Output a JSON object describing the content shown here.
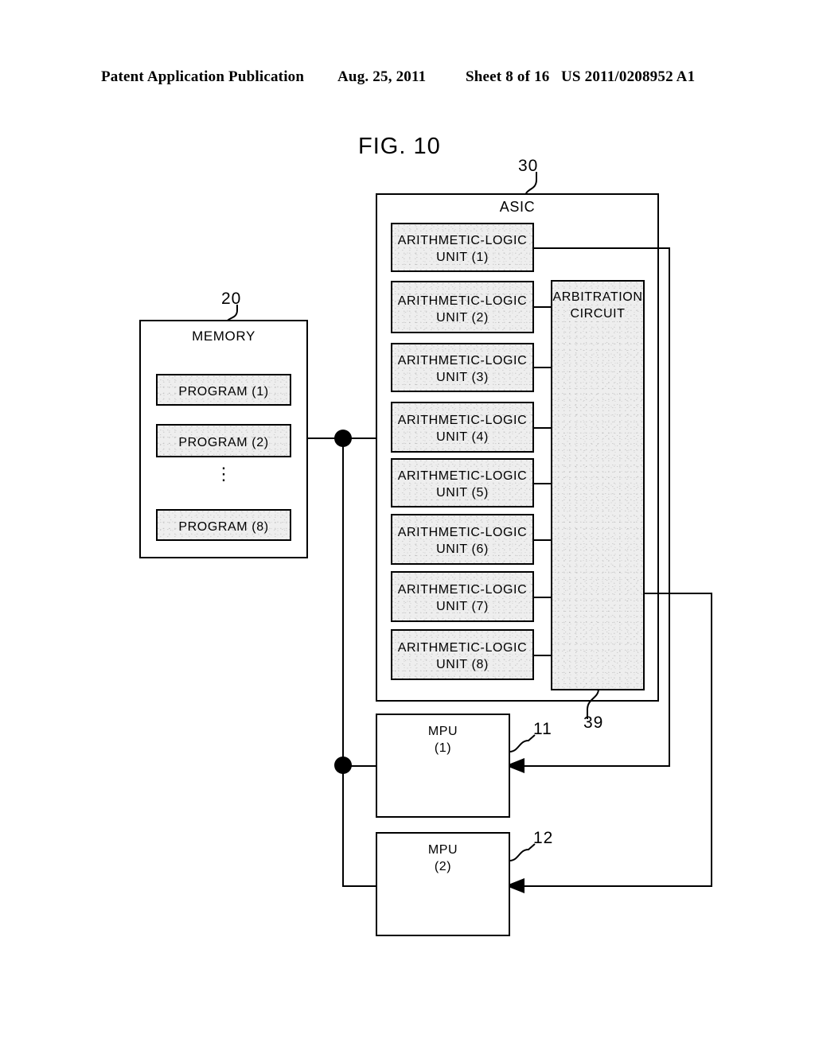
{
  "header": {
    "publication": "Patent Application Publication",
    "date": "Aug. 25, 2011",
    "sheet": "Sheet 8 of 16",
    "document_number": "US 2011/0208952 A1"
  },
  "figure": {
    "title": "FIG. 10"
  },
  "reference_numerals": {
    "asic": "30",
    "memory": "20",
    "arbitration_circuit": "39",
    "mpu1": "11",
    "mpu2": "12"
  },
  "asic": {
    "label": "ASIC",
    "units": [
      {
        "line1": "ARITHMETIC-LOGIC",
        "line2": "UNIT (1)"
      },
      {
        "line1": "ARITHMETIC-LOGIC",
        "line2": "UNIT (2)"
      },
      {
        "line1": "ARITHMETIC-LOGIC",
        "line2": "UNIT (3)"
      },
      {
        "line1": "ARITHMETIC-LOGIC",
        "line2": "UNIT (4)"
      },
      {
        "line1": "ARITHMETIC-LOGIC",
        "line2": "UNIT (5)"
      },
      {
        "line1": "ARITHMETIC-LOGIC",
        "line2": "UNIT (6)"
      },
      {
        "line1": "ARITHMETIC-LOGIC",
        "line2": "UNIT (7)"
      },
      {
        "line1": "ARITHMETIC-LOGIC",
        "line2": "UNIT (8)"
      }
    ],
    "arbitration": {
      "line1": "ARBITRATION",
      "line2": "CIRCUIT"
    }
  },
  "memory": {
    "label": "MEMORY",
    "programs": [
      {
        "label": "PROGRAM (1)"
      },
      {
        "label": "PROGRAM (2)"
      },
      {
        "label": "PROGRAM (8)"
      }
    ],
    "ellipsis": "⋮"
  },
  "mpus": [
    {
      "line1": "MPU",
      "line2": "(1)"
    },
    {
      "line1": "MPU",
      "line2": "(2)"
    }
  ],
  "colors": {
    "stroke": "#000000",
    "shade_fill": "#eeeeee",
    "page_background": "#ffffff"
  }
}
